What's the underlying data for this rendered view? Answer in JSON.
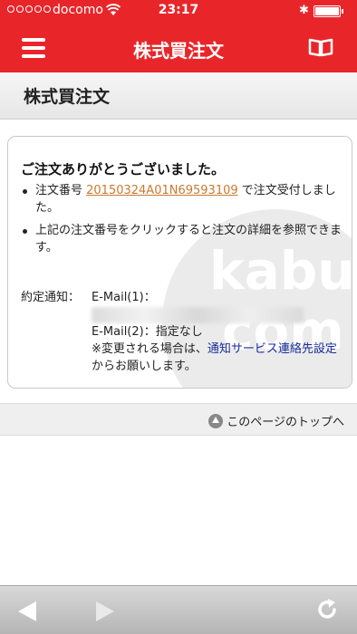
{
  "status_bar": {
    "carrier": "docomo",
    "time": "23:17"
  },
  "nav": {
    "title": "株式買注文",
    "menu_icon": "hamburger-menu-icon",
    "guide_icon": "book-icon"
  },
  "page": {
    "heading": "株式買注文"
  },
  "confirmation": {
    "thanks": "ご注文ありがとうございました。",
    "order_prefix": "注文番号 ",
    "order_number": "20150324A01N69593109",
    "order_suffix": " で注文受付しました。",
    "detail_note": "上記の注文番号をクリックすると注文の詳細を参照できます。"
  },
  "notification": {
    "label": "約定通知：",
    "email1_label": "E-Mail(1)：",
    "email2": "E-Mail(2)：指定なし",
    "change_prefix": "※変更される場合は、",
    "change_link": "通知サービス連絡先設定",
    "change_suffix": "からお願いします。"
  },
  "watermark": {
    "line1": "kabu",
    "line2": "com"
  },
  "footer": {
    "to_top": "このページのトップへ"
  },
  "toolbar": {
    "back_icon": "back-arrow-icon",
    "forward_icon": "forward-arrow-icon",
    "reload_icon": "reload-icon"
  },
  "colors": {
    "header_red": "#e8262a",
    "order_link": "#c97a2e",
    "settings_link": "#1a2e9c"
  }
}
